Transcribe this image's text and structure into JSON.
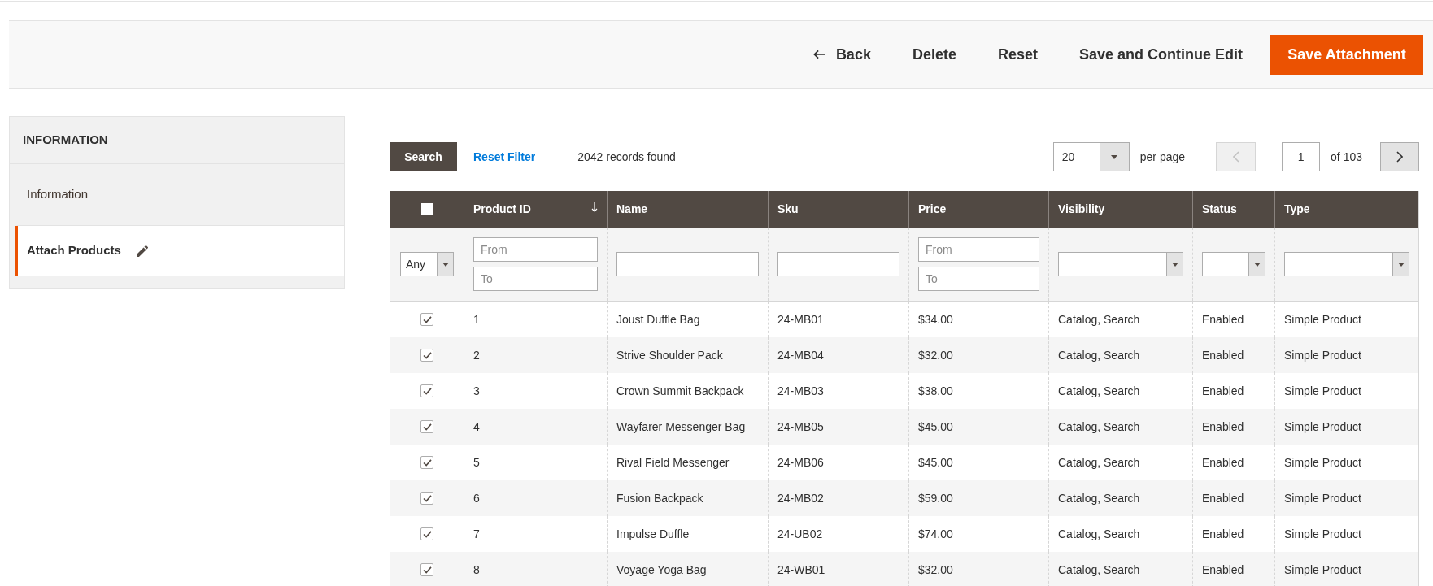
{
  "page_actions": [
    {
      "kind": "back",
      "label": "Back"
    },
    {
      "kind": "plain",
      "label": "Delete"
    },
    {
      "kind": "plain",
      "label": "Reset"
    },
    {
      "kind": "plain",
      "label": "Save and Continue Edit"
    },
    {
      "kind": "primary",
      "label": "Save Attachment"
    }
  ],
  "sidebar": {
    "title": "INFORMATION",
    "items": [
      {
        "label": "Information",
        "selected": false,
        "changed": false
      },
      {
        "label": "Attach Products",
        "selected": true,
        "changed": true
      }
    ]
  },
  "grid": {
    "toolbar": {
      "search_button": "Search",
      "reset_filter": "Reset Filter",
      "records_found": "2042 records found",
      "per_page": {
        "value": "20",
        "label": "per page"
      },
      "pager": {
        "prev": {
          "disabled": true
        },
        "page": "1",
        "total": "of 103",
        "next": {
          "disabled": false
        }
      }
    },
    "select_all": {
      "checked": false
    },
    "columns": [
      {
        "label": "Product ID",
        "sorted": true
      },
      {
        "label": "Name",
        "sorted": false
      },
      {
        "label": "Sku",
        "sorted": false
      },
      {
        "label": "Price",
        "sorted": false
      },
      {
        "label": "Visibility",
        "sorted": false
      },
      {
        "label": "Status",
        "sorted": false
      },
      {
        "label": "Type",
        "sorted": false
      }
    ],
    "filters": [
      {
        "kind": "select",
        "value": "Any"
      },
      {
        "kind": "range",
        "from_placeholder": "From",
        "to_placeholder": "To"
      },
      {
        "kind": "text"
      },
      {
        "kind": "text"
      },
      {
        "kind": "range",
        "from_placeholder": "From",
        "to_placeholder": "To"
      },
      {
        "kind": "select"
      },
      {
        "kind": "select"
      },
      {
        "kind": "select"
      }
    ],
    "rows": [
      {
        "checked": true,
        "cells": [
          "1",
          "Joust Duffle Bag",
          "24-MB01",
          "$34.00",
          "Catalog, Search",
          "Enabled",
          "Simple Product"
        ]
      },
      {
        "checked": true,
        "cells": [
          "2",
          "Strive Shoulder Pack",
          "24-MB04",
          "$32.00",
          "Catalog, Search",
          "Enabled",
          "Simple Product"
        ]
      },
      {
        "checked": true,
        "cells": [
          "3",
          "Crown Summit Backpack",
          "24-MB03",
          "$38.00",
          "Catalog, Search",
          "Enabled",
          "Simple Product"
        ]
      },
      {
        "checked": true,
        "cells": [
          "4",
          "Wayfarer Messenger Bag",
          "24-MB05",
          "$45.00",
          "Catalog, Search",
          "Enabled",
          "Simple Product"
        ]
      },
      {
        "checked": true,
        "cells": [
          "5",
          "Rival Field Messenger",
          "24-MB06",
          "$45.00",
          "Catalog, Search",
          "Enabled",
          "Simple Product"
        ]
      },
      {
        "checked": true,
        "cells": [
          "6",
          "Fusion Backpack",
          "24-MB02",
          "$59.00",
          "Catalog, Search",
          "Enabled",
          "Simple Product"
        ]
      },
      {
        "checked": true,
        "cells": [
          "7",
          "Impulse Duffle",
          "24-UB02",
          "$74.00",
          "Catalog, Search",
          "Enabled",
          "Simple Product"
        ]
      },
      {
        "checked": true,
        "cells": [
          "8",
          "Voyage Yoga Bag",
          "24-WB01",
          "$32.00",
          "Catalog, Search",
          "Enabled",
          "Simple Product"
        ]
      }
    ]
  }
}
